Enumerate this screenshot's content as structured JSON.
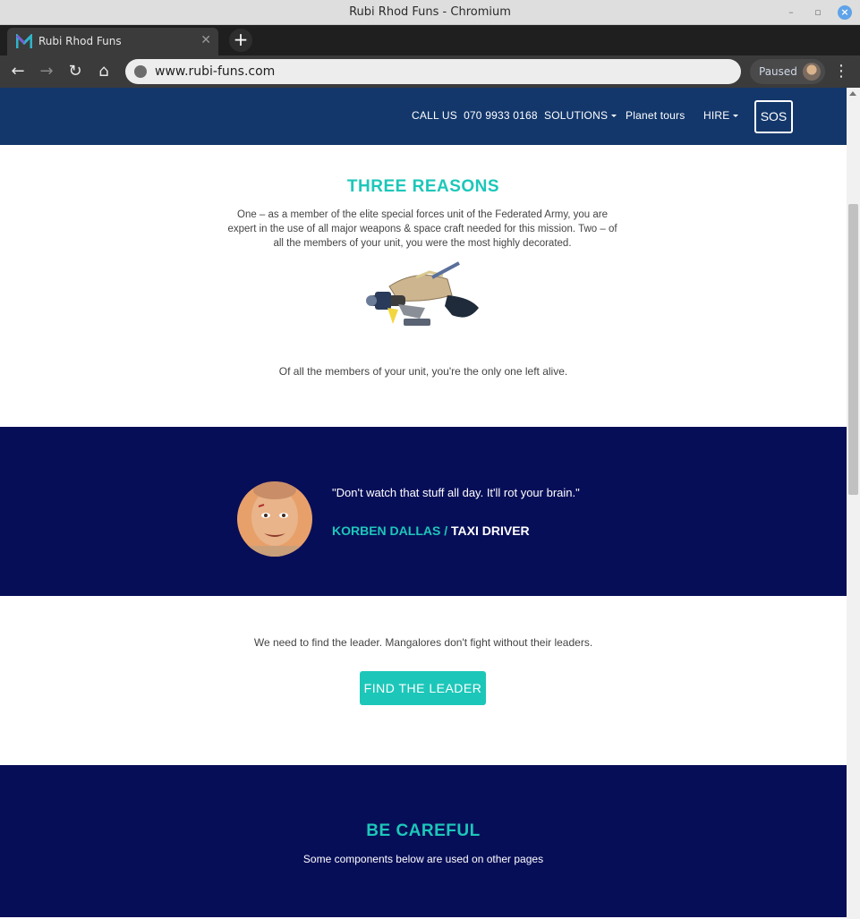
{
  "window": {
    "title": "Rubi Rhod Funs - Chromium"
  },
  "browser": {
    "tab_title": "Rubi Rhod Funs",
    "url": "www.rubi-funs.com",
    "profile_status": "Paused"
  },
  "nav": {
    "call_label": "CALL US",
    "phone": "070 9933 0168",
    "solutions": "SOLUTIONS",
    "planet_tours": "Planet tours",
    "hire": "HIRE",
    "sos": "SOS"
  },
  "reasons": {
    "heading": "THREE REASONS",
    "body": "One – as a member of the elite special forces unit of the Federated Army, you are expert in the use of all major weapons & space craft needed for this mission. Two – of all the members of your unit, you were the most highly decorated.",
    "footnote": "Of all the members of your unit, you're the only one left alive."
  },
  "quote": {
    "text": "\"Don't watch that stuff all day. It'll rot your brain.\"",
    "author_name": "KORBEN DALLAS",
    "separator": " / ",
    "author_role": "TAXI DRIVER"
  },
  "leader": {
    "text": "We need to find the leader. Mangalores don't fight without their leaders.",
    "button": "FIND THE LEADER"
  },
  "careful": {
    "heading": "BE CAREFUL",
    "sub": "Some components below are used on other pages"
  },
  "colors": {
    "accent": "#1cc7b9",
    "nav_bg": "#13376b",
    "band_bg": "#070e58"
  }
}
